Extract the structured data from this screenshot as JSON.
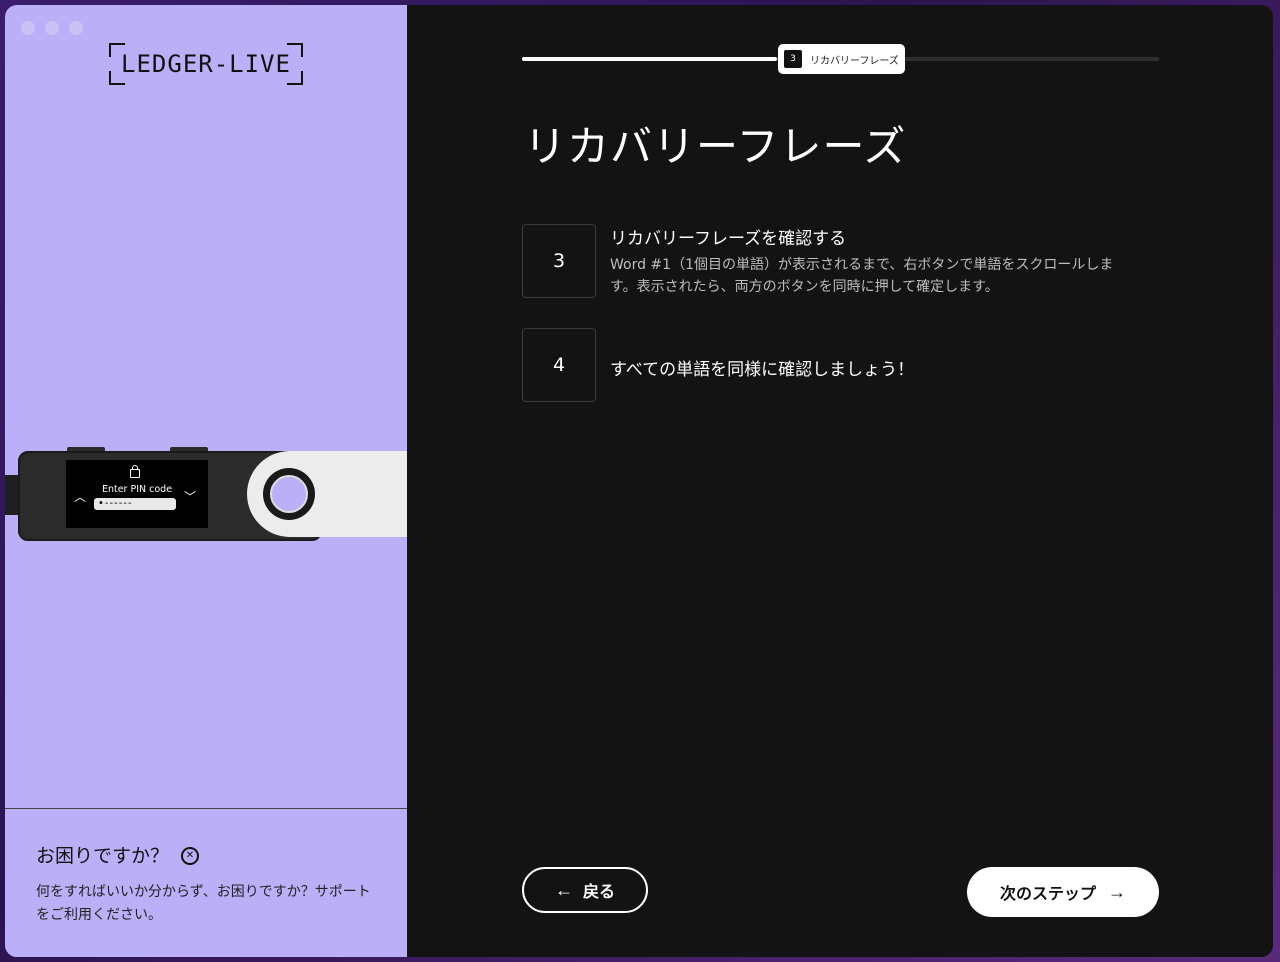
{
  "app": {
    "logo": "LEDGER-LIVE"
  },
  "device": {
    "screen_label": "Enter PIN code",
    "pin_placeholder": "•------",
    "icons": [
      "lock-icon",
      "chevron-up-icon",
      "chevron-down-icon"
    ]
  },
  "help": {
    "title": "お困りですか？",
    "icon": "lifebuoy-icon",
    "text": "何をすればいいか分からず、お困りですか？サポートをご利用ください。"
  },
  "progress": {
    "fraction": 0.4,
    "step_number": "3",
    "step_label": "リカバリーフレーズ"
  },
  "main": {
    "title": "リカバリーフレーズ",
    "steps": [
      {
        "number": "3",
        "title": "リカバリーフレーズを確認する",
        "description": "Word #1（1個目の単語）が表示されるまで、右ボタンで単語をスクロールします。表示されたら、両方のボタンを同時に押して確定します。"
      },
      {
        "number": "4",
        "title": "すべての単語を同様に確認しましょう！",
        "description": ""
      }
    ]
  },
  "footer": {
    "back_label": "戻る",
    "next_label": "次のステップ",
    "back_icon": "arrow-left-icon",
    "next_icon": "arrow-right-icon"
  }
}
